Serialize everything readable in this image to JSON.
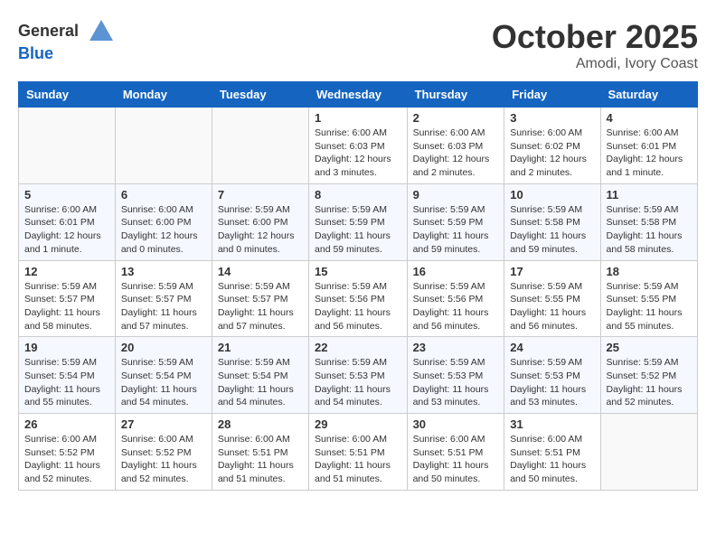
{
  "header": {
    "logo": {
      "general": "General",
      "blue": "Blue"
    },
    "title": "October 2025",
    "location": "Amodi, Ivory Coast"
  },
  "calendar": {
    "days_of_week": [
      "Sunday",
      "Monday",
      "Tuesday",
      "Wednesday",
      "Thursday",
      "Friday",
      "Saturday"
    ],
    "weeks": [
      [
        {
          "day": "",
          "info": ""
        },
        {
          "day": "",
          "info": ""
        },
        {
          "day": "",
          "info": ""
        },
        {
          "day": "1",
          "info": "Sunrise: 6:00 AM\nSunset: 6:03 PM\nDaylight: 12 hours and 3 minutes."
        },
        {
          "day": "2",
          "info": "Sunrise: 6:00 AM\nSunset: 6:03 PM\nDaylight: 12 hours and 2 minutes."
        },
        {
          "day": "3",
          "info": "Sunrise: 6:00 AM\nSunset: 6:02 PM\nDaylight: 12 hours and 2 minutes."
        },
        {
          "day": "4",
          "info": "Sunrise: 6:00 AM\nSunset: 6:01 PM\nDaylight: 12 hours and 1 minute."
        }
      ],
      [
        {
          "day": "5",
          "info": "Sunrise: 6:00 AM\nSunset: 6:01 PM\nDaylight: 12 hours and 1 minute."
        },
        {
          "day": "6",
          "info": "Sunrise: 6:00 AM\nSunset: 6:00 PM\nDaylight: 12 hours and 0 minutes."
        },
        {
          "day": "7",
          "info": "Sunrise: 5:59 AM\nSunset: 6:00 PM\nDaylight: 12 hours and 0 minutes."
        },
        {
          "day": "8",
          "info": "Sunrise: 5:59 AM\nSunset: 5:59 PM\nDaylight: 11 hours and 59 minutes."
        },
        {
          "day": "9",
          "info": "Sunrise: 5:59 AM\nSunset: 5:59 PM\nDaylight: 11 hours and 59 minutes."
        },
        {
          "day": "10",
          "info": "Sunrise: 5:59 AM\nSunset: 5:58 PM\nDaylight: 11 hours and 59 minutes."
        },
        {
          "day": "11",
          "info": "Sunrise: 5:59 AM\nSunset: 5:58 PM\nDaylight: 11 hours and 58 minutes."
        }
      ],
      [
        {
          "day": "12",
          "info": "Sunrise: 5:59 AM\nSunset: 5:57 PM\nDaylight: 11 hours and 58 minutes."
        },
        {
          "day": "13",
          "info": "Sunrise: 5:59 AM\nSunset: 5:57 PM\nDaylight: 11 hours and 57 minutes."
        },
        {
          "day": "14",
          "info": "Sunrise: 5:59 AM\nSunset: 5:57 PM\nDaylight: 11 hours and 57 minutes."
        },
        {
          "day": "15",
          "info": "Sunrise: 5:59 AM\nSunset: 5:56 PM\nDaylight: 11 hours and 56 minutes."
        },
        {
          "day": "16",
          "info": "Sunrise: 5:59 AM\nSunset: 5:56 PM\nDaylight: 11 hours and 56 minutes."
        },
        {
          "day": "17",
          "info": "Sunrise: 5:59 AM\nSunset: 5:55 PM\nDaylight: 11 hours and 56 minutes."
        },
        {
          "day": "18",
          "info": "Sunrise: 5:59 AM\nSunset: 5:55 PM\nDaylight: 11 hours and 55 minutes."
        }
      ],
      [
        {
          "day": "19",
          "info": "Sunrise: 5:59 AM\nSunset: 5:54 PM\nDaylight: 11 hours and 55 minutes."
        },
        {
          "day": "20",
          "info": "Sunrise: 5:59 AM\nSunset: 5:54 PM\nDaylight: 11 hours and 54 minutes."
        },
        {
          "day": "21",
          "info": "Sunrise: 5:59 AM\nSunset: 5:54 PM\nDaylight: 11 hours and 54 minutes."
        },
        {
          "day": "22",
          "info": "Sunrise: 5:59 AM\nSunset: 5:53 PM\nDaylight: 11 hours and 54 minutes."
        },
        {
          "day": "23",
          "info": "Sunrise: 5:59 AM\nSunset: 5:53 PM\nDaylight: 11 hours and 53 minutes."
        },
        {
          "day": "24",
          "info": "Sunrise: 5:59 AM\nSunset: 5:53 PM\nDaylight: 11 hours and 53 minutes."
        },
        {
          "day": "25",
          "info": "Sunrise: 5:59 AM\nSunset: 5:52 PM\nDaylight: 11 hours and 52 minutes."
        }
      ],
      [
        {
          "day": "26",
          "info": "Sunrise: 6:00 AM\nSunset: 5:52 PM\nDaylight: 11 hours and 52 minutes."
        },
        {
          "day": "27",
          "info": "Sunrise: 6:00 AM\nSunset: 5:52 PM\nDaylight: 11 hours and 52 minutes."
        },
        {
          "day": "28",
          "info": "Sunrise: 6:00 AM\nSunset: 5:51 PM\nDaylight: 11 hours and 51 minutes."
        },
        {
          "day": "29",
          "info": "Sunrise: 6:00 AM\nSunset: 5:51 PM\nDaylight: 11 hours and 51 minutes."
        },
        {
          "day": "30",
          "info": "Sunrise: 6:00 AM\nSunset: 5:51 PM\nDaylight: 11 hours and 50 minutes."
        },
        {
          "day": "31",
          "info": "Sunrise: 6:00 AM\nSunset: 5:51 PM\nDaylight: 11 hours and 50 minutes."
        },
        {
          "day": "",
          "info": ""
        }
      ]
    ]
  }
}
